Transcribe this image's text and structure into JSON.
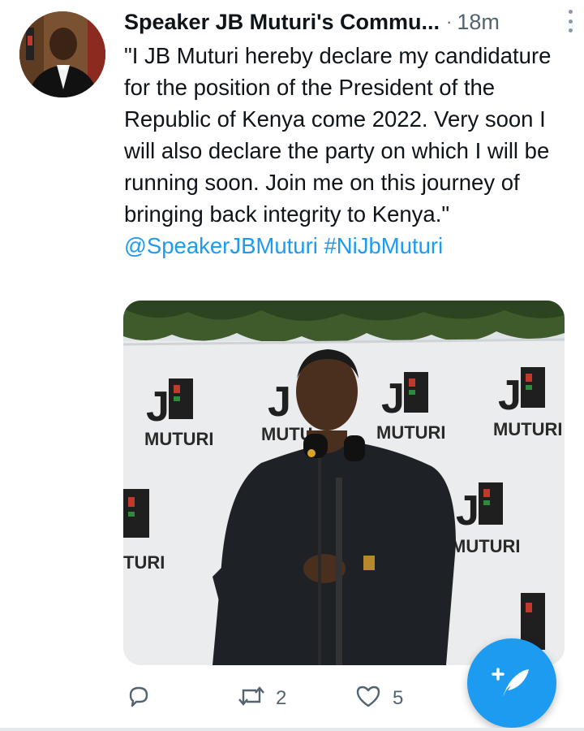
{
  "tweet": {
    "author_name": "Speaker JB Muturi's Commu...",
    "separator": "·",
    "time": "18m",
    "text_main": "\"I JB Muturi hereby declare my candidature for the position of the President of the Republic of Kenya come 2022. Very soon I will also declare the party on which I will be running soon. Join me on this journey of bringing back integrity to Kenya.\"",
    "mention": "@SpeakerJBMuturi",
    "hashtag": "#NiJbMuturi"
  },
  "media": {
    "banner_brand": "JB",
    "banner_word": "MUTURI",
    "banner_partial_right": "TURI",
    "banner_partial_mid": "MUTU"
  },
  "actions": {
    "retweet_count": "2",
    "like_count": "5"
  },
  "colors": {
    "accent": "#1d9bf0",
    "secondary_text": "#536471"
  },
  "icons": {
    "reply": "reply-icon",
    "retweet": "retweet-icon",
    "like": "heart-icon",
    "compose": "compose-feather-icon",
    "more": "more-vertical-icon"
  }
}
